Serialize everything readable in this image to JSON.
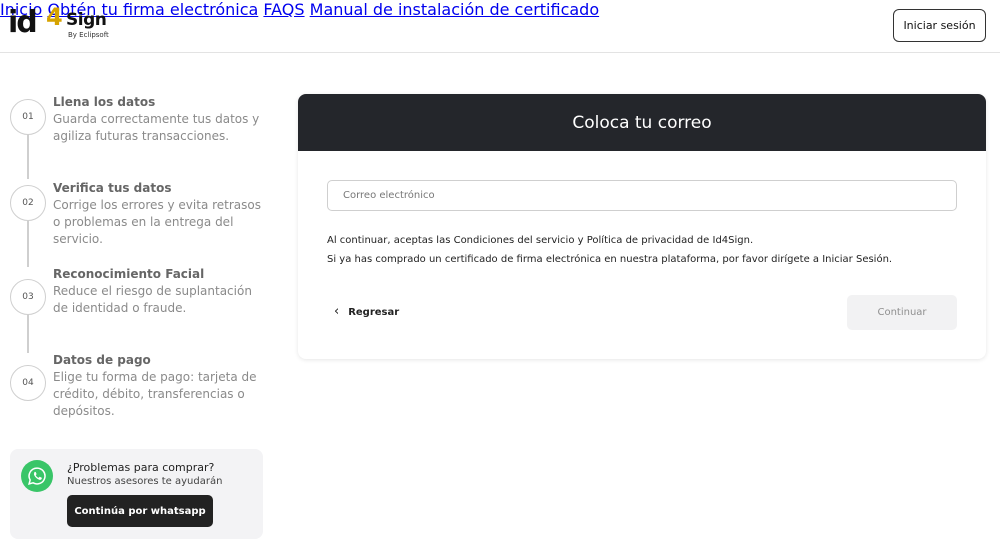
{
  "header": {
    "logo": {
      "id": "id",
      "four": "4",
      "sign": "Sign",
      "by": "By Eclipsoft"
    },
    "nav": [
      "Inicio",
      "Obtén tu firma electrónica",
      "FAQS",
      "Manual de instalación de certificado"
    ],
    "login_label": "Iniciar sesión"
  },
  "steps": [
    {
      "number": "01",
      "title": "Llena los datos",
      "desc": "Guarda correctamente tus datos y agiliza futuras transacciones."
    },
    {
      "number": "02",
      "title": "Verifica tus datos",
      "desc": "Corrige los errores y evita retrasos o problemas en la entrega del servicio."
    },
    {
      "number": "03",
      "title": "Reconocimiento Facial",
      "desc": "Reduce el riesgo de suplantación de identidad o fraude."
    },
    {
      "number": "04",
      "title": "Datos de pago",
      "desc": "Elige tu forma de pago: tarjeta de crédito, débito, transferencias o depósitos."
    }
  ],
  "help": {
    "title": "¿Problemas para comprar?",
    "subtitle": "Nuestros asesores te ayudarán",
    "button_label": "Continúa por whatsapp"
  },
  "card": {
    "title": "Coloca tu correo",
    "email_placeholder": "Correo electrónico",
    "email_value": "",
    "note_terms": "Al continuar, aceptas las Condiciones del servicio y Política de privacidad de Id4Sign.",
    "note_login": "Si ya has comprado un certificado de firma electrónica en nuestra plataforma, por favor dirígete a Iniciar Sesión.",
    "back_label": "Regresar",
    "continue_label": "Continuar"
  },
  "colors": {
    "header_dark": "#24262b",
    "whatsapp_green": "#39c568",
    "logo_accent": "#d6a300"
  }
}
